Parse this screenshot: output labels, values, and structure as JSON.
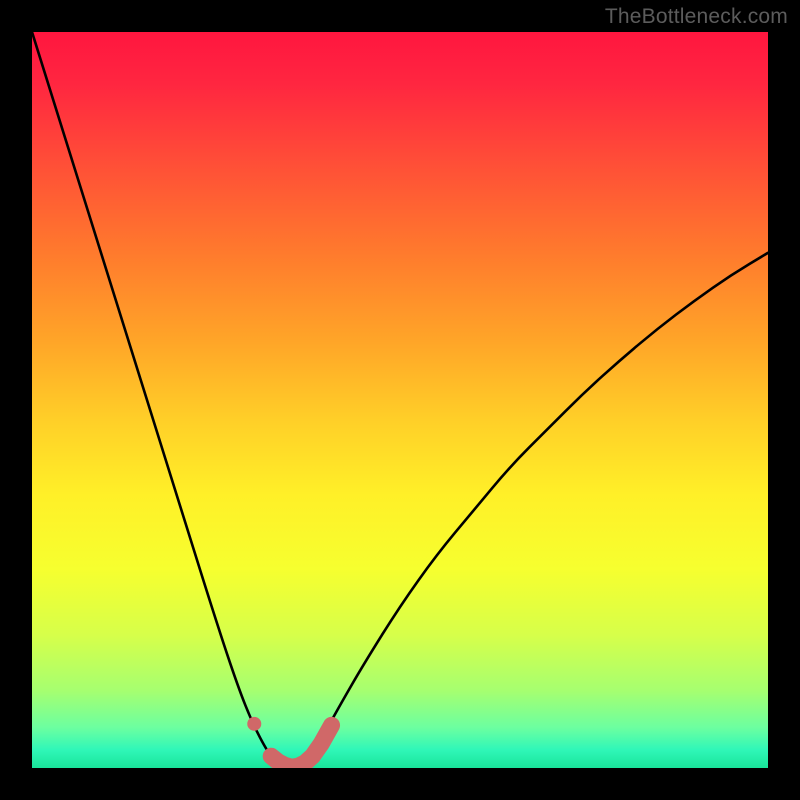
{
  "watermark": "TheBottleneck.com",
  "chart_data": {
    "type": "line",
    "title": "",
    "xlabel": "",
    "ylabel": "",
    "xlim": [
      0,
      100
    ],
    "ylim": [
      0,
      100
    ],
    "grid": false,
    "legend": false,
    "curve": {
      "description": "V-shaped bottleneck curve with minimum near x≈35; steep on left, shallower on right",
      "x": [
        0,
        5,
        10,
        15,
        20,
        25,
        28,
        30,
        32,
        33,
        34,
        35,
        36,
        37,
        38,
        40,
        42,
        45,
        50,
        55,
        60,
        65,
        70,
        75,
        80,
        85,
        90,
        95,
        100
      ],
      "y": [
        100,
        84,
        68,
        52,
        36,
        20,
        11,
        6,
        2.2,
        1.1,
        0.4,
        0.0,
        0.3,
        1.0,
        2.0,
        5.2,
        8.8,
        14,
        22,
        29,
        35,
        41,
        46,
        51,
        55.5,
        59.7,
        63.5,
        67,
        70
      ]
    },
    "datapoints": {
      "description": "Highlighted pink/salmon markers near the trough of the curve",
      "color": "#d06868",
      "x": [
        30.2,
        32.5,
        33.5,
        34.4,
        35.3,
        36.2,
        37.1,
        38.1,
        39.3,
        40.7
      ],
      "y": [
        6.0,
        1.6,
        0.8,
        0.35,
        0.1,
        0.25,
        0.7,
        1.6,
        3.3,
        5.8
      ]
    },
    "gradient_background": {
      "description": "Vertical rainbow from red (top=high bottleneck) through orange, yellow, lime to green (bottom=no bottleneck)",
      "stops": [
        {
          "pos": 0.0,
          "color": "#ff163f"
        },
        {
          "pos": 0.07,
          "color": "#ff2640"
        },
        {
          "pos": 0.18,
          "color": "#ff4f37"
        },
        {
          "pos": 0.3,
          "color": "#ff7a2d"
        },
        {
          "pos": 0.42,
          "color": "#ffa528"
        },
        {
          "pos": 0.53,
          "color": "#ffd028"
        },
        {
          "pos": 0.63,
          "color": "#fff028"
        },
        {
          "pos": 0.73,
          "color": "#f6ff2f"
        },
        {
          "pos": 0.82,
          "color": "#d6ff4a"
        },
        {
          "pos": 0.895,
          "color": "#a6ff70"
        },
        {
          "pos": 0.945,
          "color": "#6cffa0"
        },
        {
          "pos": 0.975,
          "color": "#30f7b8"
        },
        {
          "pos": 1.0,
          "color": "#19e49a"
        }
      ]
    }
  }
}
